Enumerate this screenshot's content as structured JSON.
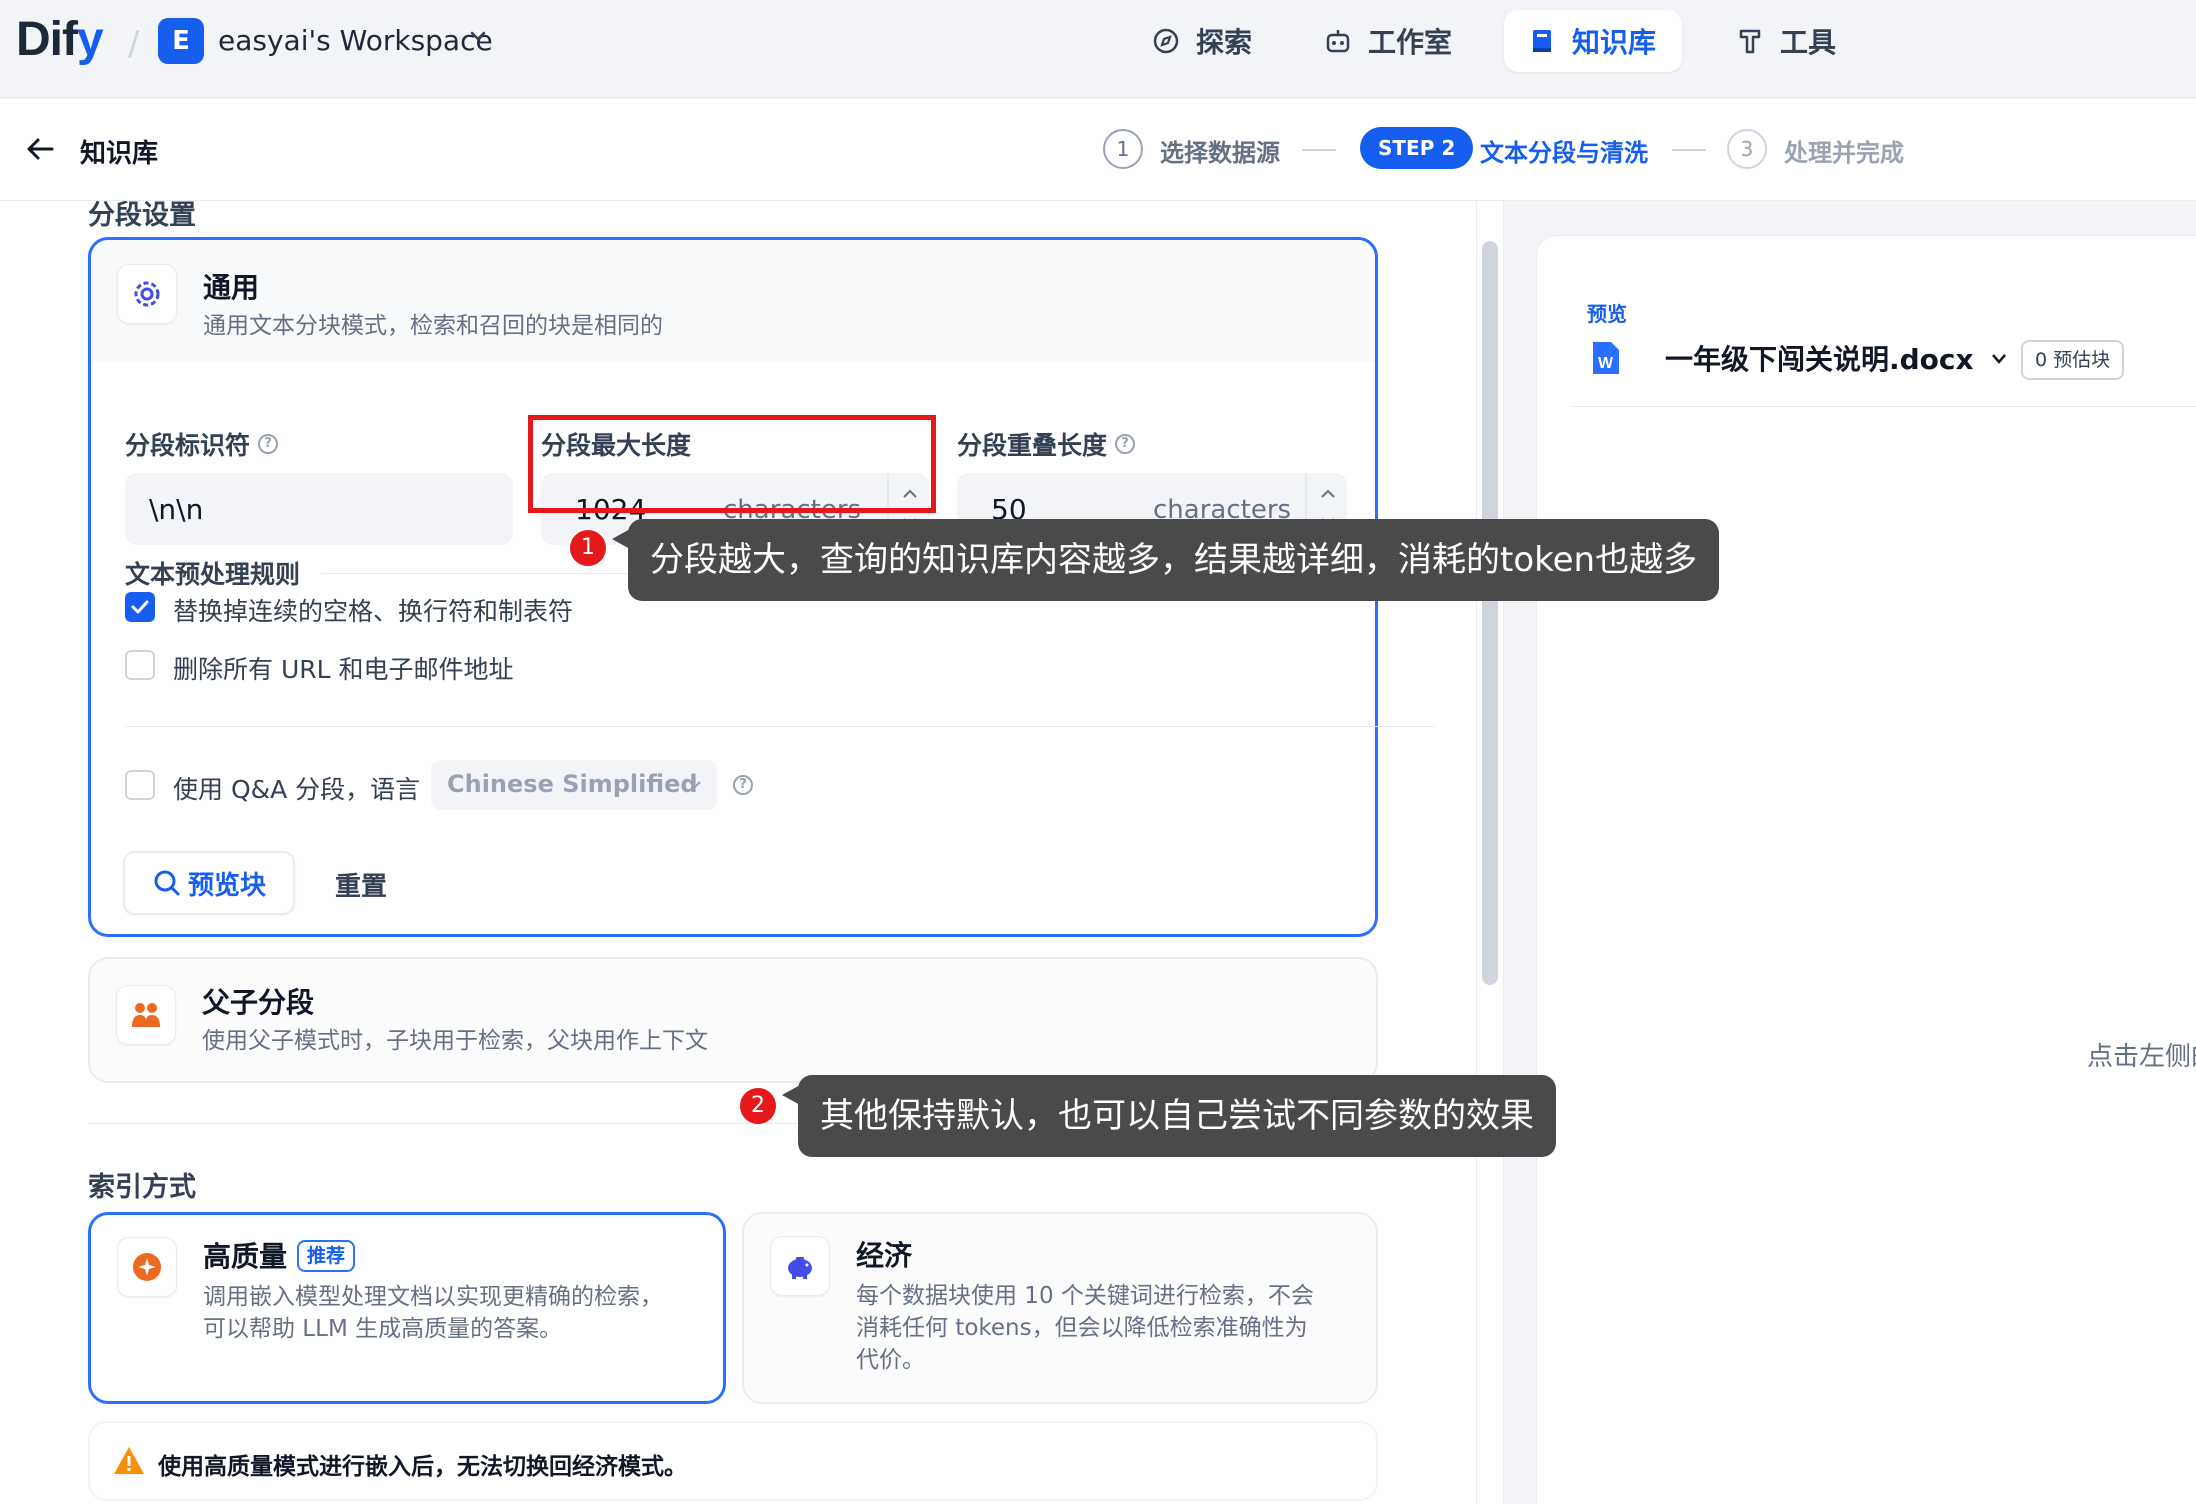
{
  "header": {
    "logo_main": "Dif",
    "logo_accent": "y",
    "workspace_initial": "E",
    "workspace_name": "easyai's Workspace",
    "nav": [
      {
        "label": "探索"
      },
      {
        "label": "工作室"
      },
      {
        "label": "知识库"
      },
      {
        "label": "工具"
      }
    ]
  },
  "subheader": {
    "breadcrumb": "知识库",
    "steps": [
      {
        "num": "1",
        "label": "选择数据源"
      },
      {
        "num": "STEP 2",
        "label": "文本分段与清洗"
      },
      {
        "num": "3",
        "label": "处理并完成"
      }
    ]
  },
  "segment": {
    "section_title": "分段设置",
    "general": {
      "title": "通用",
      "desc": "通用文本分块模式，检索和召回的块是相同的",
      "identifier_label": "分段标识符",
      "identifier_value": "\\n\\n",
      "max_len_label": "分段最大长度",
      "max_len_value": "1024",
      "overlap_label": "分段重叠长度",
      "overlap_value": "50",
      "unit": "characters",
      "rules_label": "文本预处理规则",
      "rule1": "替换掉连续的空格、换行符和制表符",
      "rule1_checked": true,
      "rule2": "删除所有 URL 和电子邮件地址",
      "rule2_checked": false,
      "qa_label": "使用 Q&A 分段，语言",
      "qa_lang": "Chinese Simplified",
      "preview_btn": "预览块",
      "reset_btn": "重置"
    },
    "parent_child": {
      "title": "父子分段",
      "desc": "使用父子模式时，子块用于检索，父块用作上下文"
    }
  },
  "index": {
    "section_title": "索引方式",
    "high": {
      "title": "高质量",
      "badge": "推荐",
      "desc1": "调用嵌入模型处理文档以实现更精确的检索，",
      "desc2": "可以帮助 LLM 生成高质量的答案。"
    },
    "eco": {
      "title": "经济",
      "desc1": "每个数据块使用 10 个关键词进行检索，不会",
      "desc2": "消耗任何 tokens，但会以降低检索准确性为",
      "desc3": "代价。"
    },
    "warning": "使用高质量模式进行嵌入后，无法切换回经济模式。"
  },
  "preview": {
    "tag": "预览",
    "doc_name": "一年级下闯关说明.docx",
    "count": "0 预估块",
    "hint": "点击左侧的"
  },
  "annotations": {
    "a1_num": "1",
    "a1_text": "分段越大，查询的知识库内容越多，结果越详细，消耗的token也越多",
    "a2_num": "2",
    "a2_text": "其他保持默认，也可以自己尝试不同参数的效果"
  },
  "colors": {
    "primary": "#155eef",
    "annotation_red": "#e5191c",
    "tooltip_bg": "#4a4a4a"
  }
}
